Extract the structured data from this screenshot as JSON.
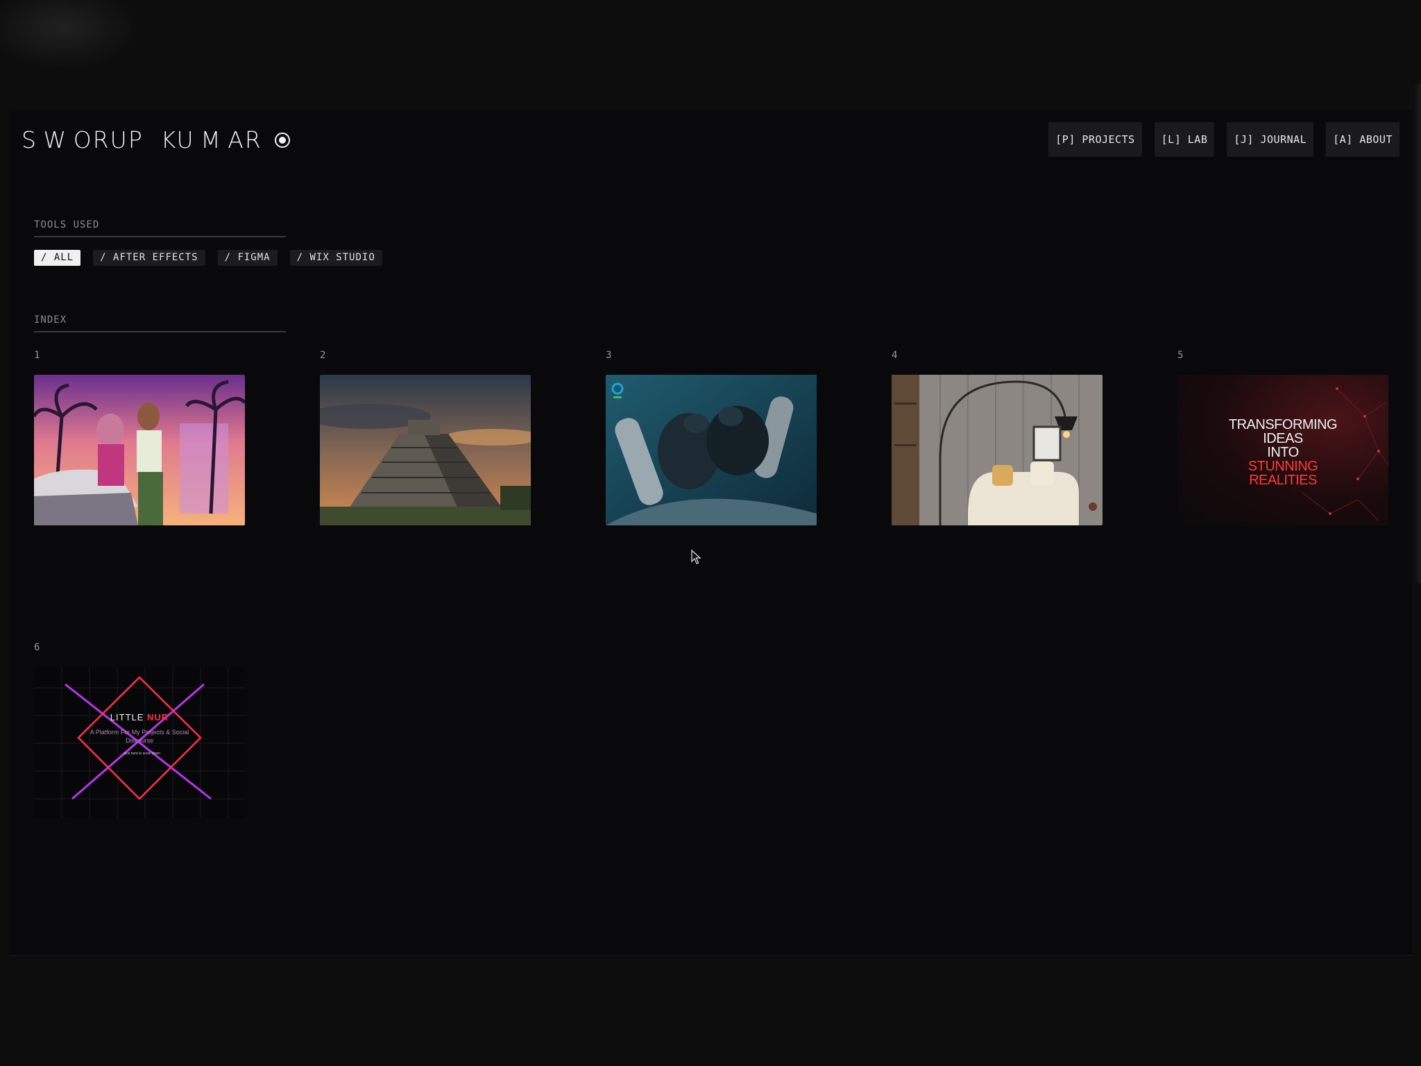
{
  "header": {
    "logo_text": "S W ORUP  KU M AR",
    "nav": [
      {
        "label": "[P] PROJECTS"
      },
      {
        "label": "[L] LAB"
      },
      {
        "label": "[J] JOURNAL"
      },
      {
        "label": "[A] ABOUT"
      }
    ]
  },
  "tools": {
    "label": "TOOLS USED",
    "filters": [
      {
        "label": "/ ALL",
        "active": true
      },
      {
        "label": "/ AFTER EFFECTS",
        "active": false
      },
      {
        "label": "/ FIGMA",
        "active": false
      },
      {
        "label": "/ WIX STUDIO",
        "active": false
      }
    ]
  },
  "index": {
    "label": "INDEX",
    "projects": [
      {
        "num": "1",
        "thumb": "sunset-palms-couple-artwork"
      },
      {
        "num": "2",
        "thumb": "mayan-pyramid-sunset"
      },
      {
        "num": "3",
        "thumb": "scuba-divers-underwater"
      },
      {
        "num": "4",
        "thumb": "living-room-arc-lamp"
      },
      {
        "num": "5",
        "thumb": "transforming-ideas-banner",
        "lines": [
          "TRANSFORMING",
          "IDEAS",
          "INTO"
        ],
        "highlight": [
          "STUNNING",
          "REALITIES"
        ]
      },
      {
        "num": "6",
        "thumb": "little-neon-banner",
        "title": "LITTLE",
        "title_accent": "NUR",
        "subtitle": "A Platform For My Projects & Social Discourse",
        "small": "→ click here to scroll down"
      }
    ]
  },
  "colors": {
    "background": "#0d0d0e",
    "panel": "#09090b",
    "accent_red": "#ff3b3b",
    "neon_magenta": "#c83cff"
  }
}
